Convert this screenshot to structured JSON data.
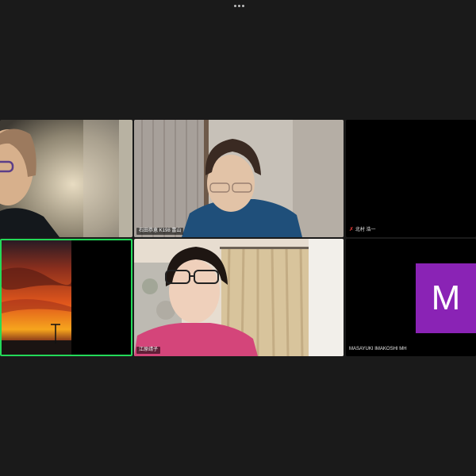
{
  "top_bar": {
    "more_icon": "ellipsis-icon"
  },
  "participants": [
    {
      "id": "p1",
      "name": "",
      "video": "on",
      "muted": false
    },
    {
      "id": "p2",
      "name": "石田恭恵 K198 富山",
      "video": "on",
      "muted": false
    },
    {
      "id": "p3",
      "name": "北村 浩一",
      "video": "off",
      "muted": true
    },
    {
      "id": "p4",
      "name": "",
      "video": "on",
      "muted": false,
      "speaking": true
    },
    {
      "id": "p5",
      "name": "江原靖子",
      "video": "on",
      "muted": false
    },
    {
      "id": "p6",
      "name": "MASAYUKI IMAKOSHI MH",
      "video": "off",
      "muted": false,
      "avatar_letter": "M"
    }
  ],
  "colors": {
    "background": "#1a1a1a",
    "speaking_border": "#23d959",
    "avatar_bg": "#8a23b5",
    "mute_icon": "#e53935"
  }
}
